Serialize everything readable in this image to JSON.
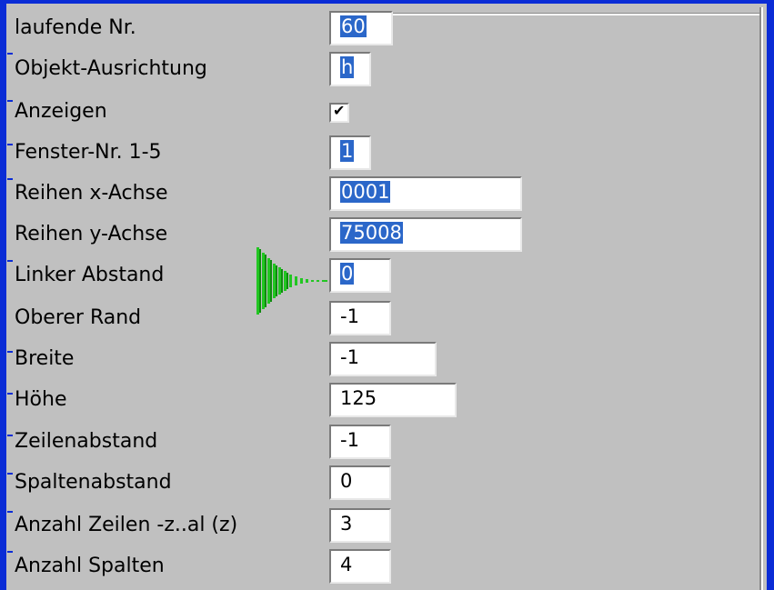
{
  "form": {
    "rows": [
      {
        "label": "laufende Nr.",
        "value": "60"
      },
      {
        "label": "Objekt-Ausrichtung",
        "value": "h"
      },
      {
        "label": "Anzeigen",
        "checked": true
      },
      {
        "label": "Fenster-Nr. 1-5",
        "value": "1"
      },
      {
        "label": "Reihen x-Achse",
        "value": "0001"
      },
      {
        "label": "Reihen y-Achse",
        "value": "75008"
      },
      {
        "label": "Linker Abstand",
        "value": "0"
      },
      {
        "label": "Oberer Rand",
        "value": "-1"
      },
      {
        "label": "Breite",
        "value": "-1"
      },
      {
        "label": "Höhe",
        "value": "125"
      },
      {
        "label": "Zeilenabstand",
        "value": "-1"
      },
      {
        "label": "Spaltenabstand",
        "value": "0"
      },
      {
        "label": "Anzahl Zeilen -z..al (z)",
        "value": "3"
      },
      {
        "label": "Anzahl Spalten",
        "value": "4"
      }
    ],
    "checkmark": "✔"
  },
  "colors": {
    "frame": "#0a2cd6",
    "selection": "#2b67c9",
    "pointer_arrow": "#22c622",
    "background": "#c0c0c0"
  },
  "icons": {
    "pointer": "green-arrow-pointer-icon"
  }
}
